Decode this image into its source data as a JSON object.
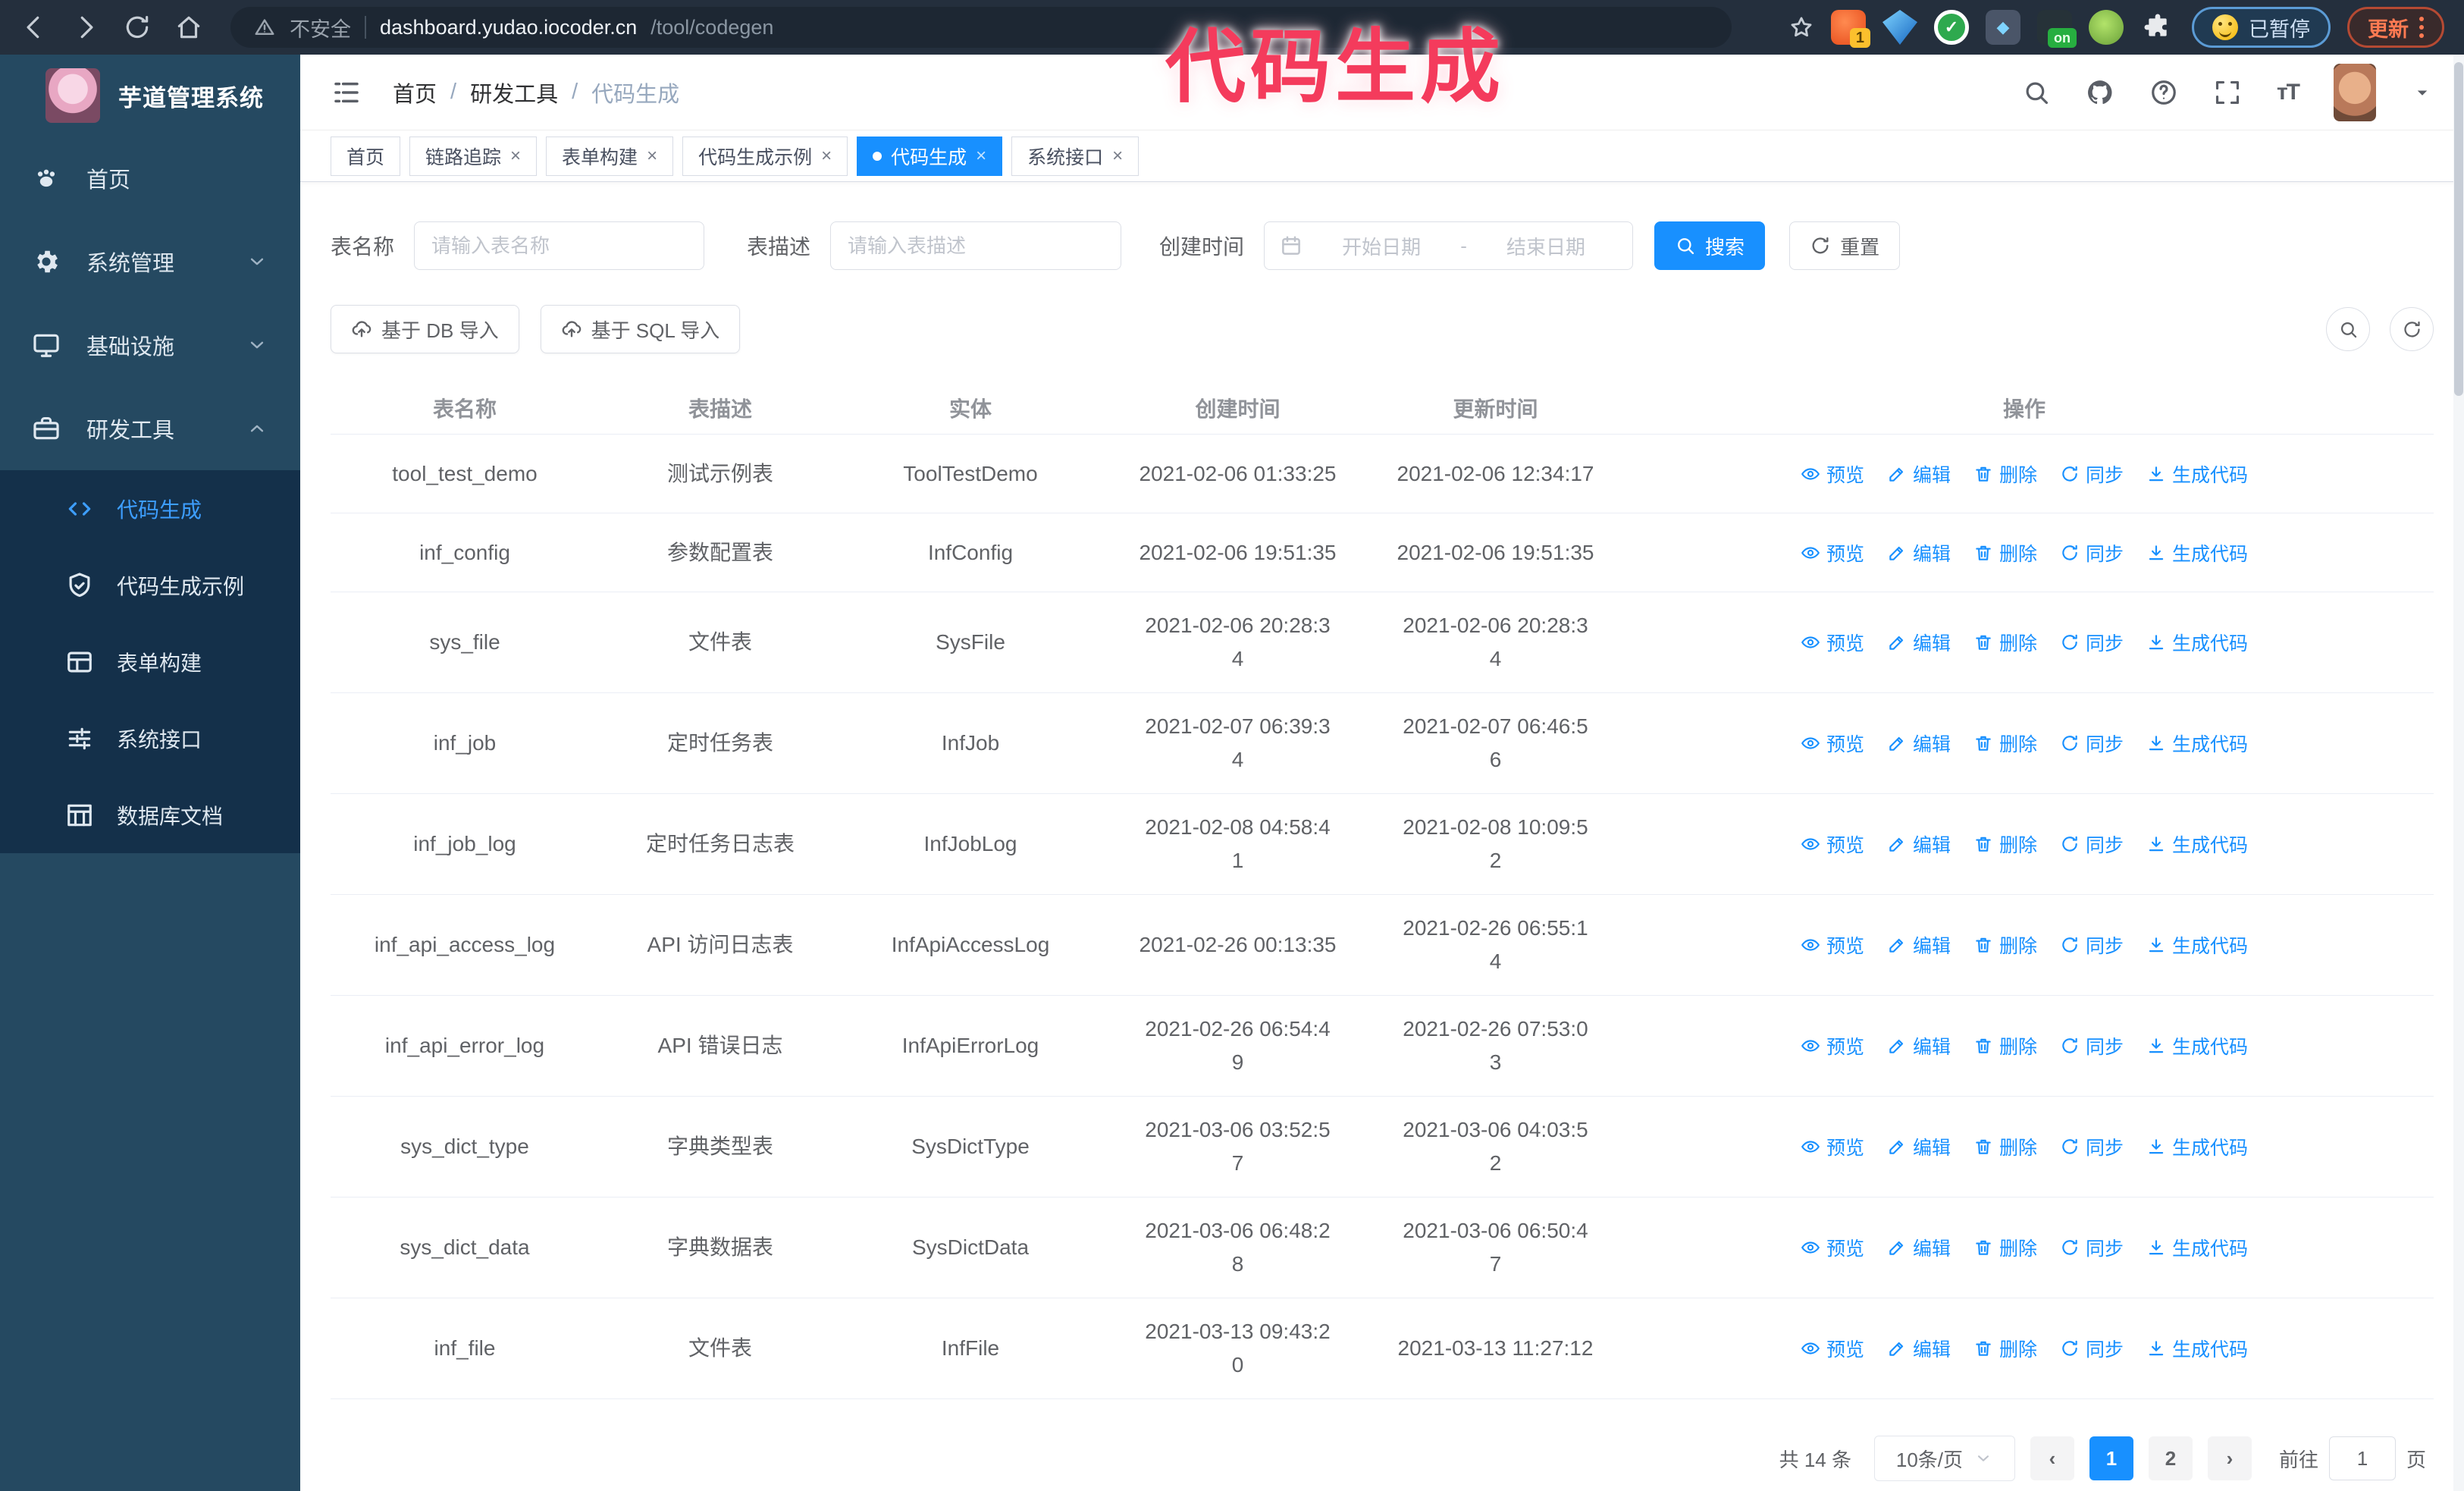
{
  "colors": {
    "primary": "#1890ff",
    "watermark_pink": "#f43b5c",
    "sidebar_bg": "#254961",
    "submenu_bg": "#14304a",
    "active_menu_text": "#3d9eff"
  },
  "browser": {
    "security_label": "不安全",
    "url_host": "dashboard.yudao.iocoder.cn",
    "url_path": "/tool/codegen",
    "ext_badge_1": "1",
    "ext_on_badge": "on",
    "paused_badge": "已暂停",
    "update_button": "更新"
  },
  "sidebar": {
    "app_title": "芋道管理系统",
    "items": [
      {
        "label": "首页",
        "icon": "paw-icon",
        "chevron": "none"
      },
      {
        "label": "系统管理",
        "icon": "gear-icon",
        "chevron": "down"
      },
      {
        "label": "基础设施",
        "icon": "monitor-icon",
        "chevron": "down"
      },
      {
        "label": "研发工具",
        "icon": "toolbox-icon",
        "chevron": "up"
      }
    ],
    "submenu": [
      {
        "label": "代码生成",
        "icon": "code-icon",
        "active": true
      },
      {
        "label": "代码生成示例",
        "icon": "shield-check-icon",
        "active": false
      },
      {
        "label": "表单构建",
        "icon": "form-icon",
        "active": false
      },
      {
        "label": "系统接口",
        "icon": "sliders-icon",
        "active": false
      },
      {
        "label": "数据库文档",
        "icon": "table-columns-icon",
        "active": false
      }
    ]
  },
  "header": {
    "breadcrumb": [
      "首页",
      "研发工具",
      "代码生成"
    ],
    "watermark": "代码生成"
  },
  "tabs": [
    {
      "label": "首页",
      "closable": false,
      "active": false
    },
    {
      "label": "链路追踪",
      "closable": true,
      "active": false
    },
    {
      "label": "表单构建",
      "closable": true,
      "active": false
    },
    {
      "label": "代码生成示例",
      "closable": true,
      "active": false
    },
    {
      "label": "代码生成",
      "closable": true,
      "active": true
    },
    {
      "label": "系统接口",
      "closable": true,
      "active": false
    }
  ],
  "filters": {
    "table_name_label": "表名称",
    "table_name_placeholder": "请输入表名称",
    "table_desc_label": "表描述",
    "table_desc_placeholder": "请输入表描述",
    "create_time_label": "创建时间",
    "start_placeholder": "开始日期",
    "range_separator": "-",
    "end_placeholder": "结束日期",
    "search_label": "搜索",
    "reset_label": "重置"
  },
  "toolbar": {
    "import_db_label": "基于 DB 导入",
    "import_sql_label": "基于 SQL 导入"
  },
  "table": {
    "columns": [
      "表名称",
      "表描述",
      "实体",
      "创建时间",
      "更新时间",
      "操作"
    ],
    "row_actions": [
      {
        "label": "预览",
        "icon": "eye-icon"
      },
      {
        "label": "编辑",
        "icon": "edit-icon"
      },
      {
        "label": "删除",
        "icon": "trash-icon"
      },
      {
        "label": "同步",
        "icon": "sync-icon"
      },
      {
        "label": "生成代码",
        "icon": "download-icon"
      }
    ],
    "rows": [
      {
        "name": "tool_test_demo",
        "desc": "测试示例表",
        "entity": "ToolTestDemo",
        "created": "2021-02-06 01:33:25",
        "updated": "2021-02-06 12:34:17"
      },
      {
        "name": "inf_config",
        "desc": "参数配置表",
        "entity": "InfConfig",
        "created": "2021-02-06 19:51:35",
        "updated": "2021-02-06 19:51:35"
      },
      {
        "name": "sys_file",
        "desc": "文件表",
        "entity": "SysFile",
        "created": "2021-02-06 20:28:3\n4",
        "updated": "2021-02-06 20:28:3\n4"
      },
      {
        "name": "inf_job",
        "desc": "定时任务表",
        "entity": "InfJob",
        "created": "2021-02-07 06:39:3\n4",
        "updated": "2021-02-07 06:46:5\n6"
      },
      {
        "name": "inf_job_log",
        "desc": "定时任务日志表",
        "entity": "InfJobLog",
        "created": "2021-02-08 04:58:4\n1",
        "updated": "2021-02-08 10:09:5\n2"
      },
      {
        "name": "inf_api_access_log",
        "desc": "API 访问日志表",
        "entity": "InfApiAccessLog",
        "created": "2021-02-26 00:13:35",
        "updated": "2021-02-26 06:55:1\n4"
      },
      {
        "name": "inf_api_error_log",
        "desc": "API 错误日志",
        "entity": "InfApiErrorLog",
        "created": "2021-02-26 06:54:4\n9",
        "updated": "2021-02-26 07:53:0\n3"
      },
      {
        "name": "sys_dict_type",
        "desc": "字典类型表",
        "entity": "SysDictType",
        "created": "2021-03-06 03:52:5\n7",
        "updated": "2021-03-06 04:03:5\n2"
      },
      {
        "name": "sys_dict_data",
        "desc": "字典数据表",
        "entity": "SysDictData",
        "created": "2021-03-06 06:48:2\n8",
        "updated": "2021-03-06 06:50:4\n7"
      },
      {
        "name": "inf_file",
        "desc": "文件表",
        "entity": "InfFile",
        "created": "2021-03-13 09:43:2\n0",
        "updated": "2021-03-13 11:27:12"
      }
    ]
  },
  "pagination": {
    "total_label": "共 14 条",
    "page_size": "10条/页",
    "pages": [
      "1",
      "2"
    ],
    "active_page": "1",
    "goto_label": "前往",
    "goto_value": "1",
    "page_suffix": "页"
  }
}
